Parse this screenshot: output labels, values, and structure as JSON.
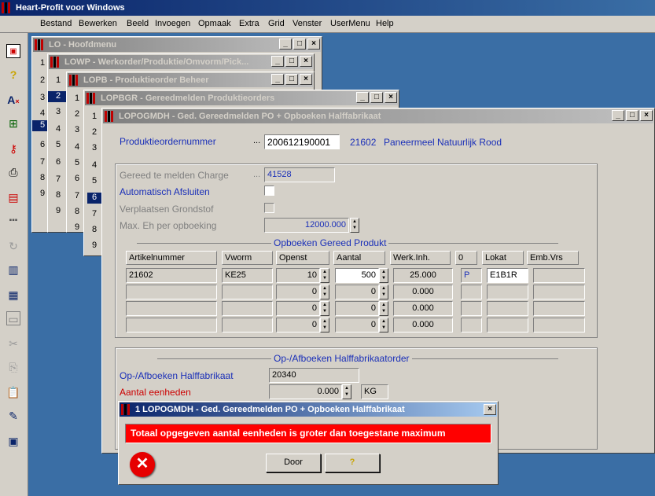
{
  "app": {
    "title": "Heart-Profit voor Windows"
  },
  "menu": [
    "Bestand",
    "Bewerken",
    "Beeld",
    "Invoegen",
    "Opmaak",
    "Extra",
    "Grid",
    "Venster",
    "UserMenu",
    "Help"
  ],
  "toolbar_icons": [
    "report-icon",
    "help-icon",
    "font-icon",
    "tree-icon",
    "key-icon",
    "print-icon",
    "form-icon",
    "dots-icon",
    "refresh-icon",
    "export-icon",
    "chart-icon",
    "window-icon",
    "cut-icon",
    "copy-icon",
    "paste-icon",
    "edit-icon",
    "monitor-icon"
  ],
  "windows": {
    "lo": {
      "title": "LO - Hoofdmenu",
      "items": [
        "1",
        "2",
        "3",
        "4",
        "5",
        "6",
        "7",
        "8",
        "9"
      ]
    },
    "lowp": {
      "title": "LOWP - Werkorder/Produktie/Omvorm/Pick...",
      "items": [
        "1",
        "2",
        "3",
        "4",
        "5",
        "6",
        "7",
        "8",
        "9"
      ]
    },
    "lopb": {
      "title": "LOPB - Produktieorder Beheer",
      "items": [
        "1",
        "2",
        "3",
        "4",
        "5",
        "6",
        "7",
        "8",
        "9"
      ]
    },
    "lopbgr": {
      "title": "LOPBGR - Gereedmelden Produktieorders",
      "items": [
        "1",
        "2",
        "3",
        "4",
        "5",
        "6",
        "7",
        "8",
        "9"
      ]
    },
    "main": {
      "title": "LOPOGMDH - Ged. Gereedmelden PO + Opboeken Halffabrikaat"
    }
  },
  "form": {
    "po_label": "Produktieordernummer",
    "po_value": "200612190001",
    "ellipsis": "...",
    "article_code": "21602",
    "article_desc": "Paneermeel Natuurlijk Rood",
    "charge_label": "Gereed te melden Charge",
    "charge_value": "41528",
    "auto_close_label": "Automatisch Afsluiten",
    "move_label": "Verplaatsen Grondstof",
    "max_label": "Max. Eh per opboeking",
    "max_value": "12000.000"
  },
  "grid": {
    "title": "Opboeken Gereed Produkt",
    "headers": [
      "Artikelnummer",
      "Vworm",
      "Openst",
      "Aantal",
      "Werk.Inh.",
      "0",
      "Lokat",
      "Emb.Vrs"
    ],
    "rows": [
      [
        "21602",
        "KE25",
        "10",
        "500",
        "25.000",
        "P",
        "E1B1R",
        ""
      ],
      [
        "",
        "",
        "0",
        "0",
        "0.000",
        "",
        "",
        ""
      ],
      [
        "",
        "",
        "0",
        "0",
        "0.000",
        "",
        "",
        ""
      ],
      [
        "",
        "",
        "0",
        "0",
        "0.000",
        "",
        "",
        ""
      ]
    ]
  },
  "half": {
    "title": "Op-/Afboeken Halffabrikaatorder",
    "label": "Op-/Afboeken Halffabrikaat",
    "value": "20340",
    "units_label": "Aantal eenheden",
    "units_value": "0.000",
    "unit": "KG"
  },
  "dialog": {
    "title": "1 LOPOGMDH - Ged. Gereedmelden PO + Opboeken Halffabrikaat",
    "message": "Totaal opgegeven aantal eenheden is groter dan toegestane maximum",
    "ok_label": "Door",
    "help_label": "?"
  },
  "colors": {
    "accent": "#0a246a",
    "error": "#ff0000",
    "label_blue": "#1a2fb8"
  }
}
